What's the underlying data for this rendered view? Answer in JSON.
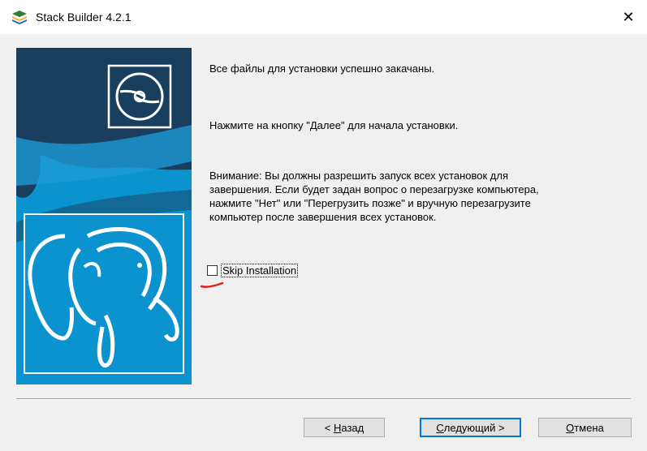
{
  "window": {
    "title": "Stack Builder 4.2.1",
    "close_symbol": "✕"
  },
  "content": {
    "line1": "Все файлы для установки успешно закачаны.",
    "line2": "Нажмите на кнопку \"Далее\" для начала установки.",
    "warning": "Внимание: Вы должны разрешить запуск всех установок для\nзавершения. Если будет задан вопрос о перезагрузке компьютера,\nнажмите \"Нет\" или \"Перегрузить позже\" и вручную перезагрузите\nкомпьютер после завершения всех установок."
  },
  "skip_installation": {
    "label": "Skip Installation",
    "checked": false
  },
  "buttons": {
    "back": {
      "mnemonic": "Н",
      "rest": "азад",
      "prefix": "< "
    },
    "next": {
      "mnemonic": "С",
      "rest": "ледующий >"
    },
    "cancel": {
      "mnemonic": "О",
      "rest": "тмена"
    }
  },
  "colors": {
    "banner_dark": "#1a3f5e",
    "banner_blue": "#0a93cf",
    "default_button_border": "#0078d7",
    "annotation_red": "#e0201b"
  },
  "icons": {
    "app": "stack-builder-layers-icon",
    "disc": "disc-icon",
    "elephant": "postgresql-elephant-logo"
  }
}
